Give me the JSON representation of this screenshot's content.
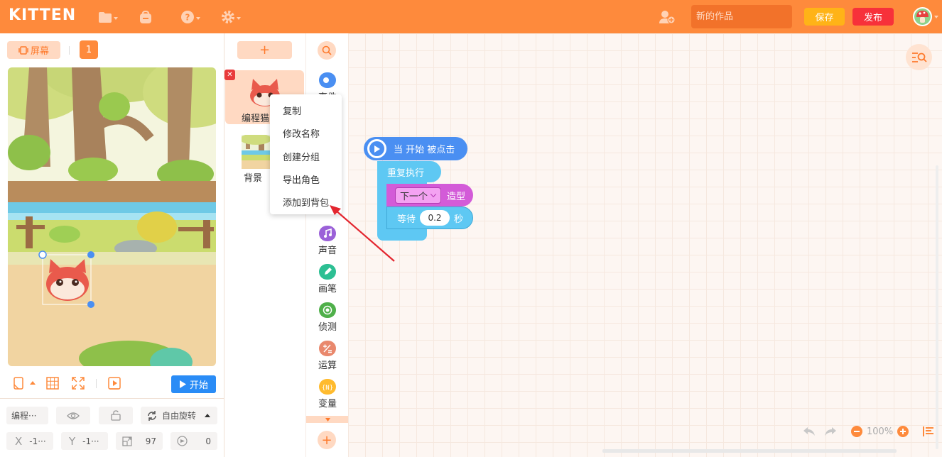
{
  "topbar": {
    "logo": "KITTEN",
    "title_placeholder": "新的作品",
    "save_label": "保存",
    "publish_label": "发布"
  },
  "stage": {
    "screen_label": "屏幕",
    "screen_number": "1",
    "start_label": "开始"
  },
  "properties": {
    "name": "编程···",
    "rotation_mode": "自由旋转",
    "x_label": "X",
    "x_value": "-1···",
    "y_label": "Y",
    "y_value": "-1···",
    "size_value": "97",
    "direction_value": "0"
  },
  "sprites": {
    "add_label": "+",
    "sprite_name": "编程猫",
    "background_name": "背景"
  },
  "context_menu": {
    "items": [
      "复制",
      "修改名称",
      "创建分组",
      "导出角色",
      "添加到背包"
    ]
  },
  "categories": [
    {
      "label": "事件",
      "color": "#4a8ff2"
    },
    {
      "label": "声音",
      "color": "#9b61d8"
    },
    {
      "label": "画笔",
      "color": "#2cbf93"
    },
    {
      "label": "侦测",
      "color": "#4fb04a"
    },
    {
      "label": "运算",
      "color": "#e9886d"
    },
    {
      "label": "变量",
      "color": "#ffbb2e"
    }
  ],
  "blocks": {
    "hat_label": "当 开始 被点击",
    "repeat_label": "重复执行",
    "costume_dropdown": "下一个",
    "costume_label": "造型",
    "wait_label": "等待",
    "wait_value": "0.2",
    "wait_unit": "秒"
  },
  "zoom": {
    "level": "100%"
  }
}
